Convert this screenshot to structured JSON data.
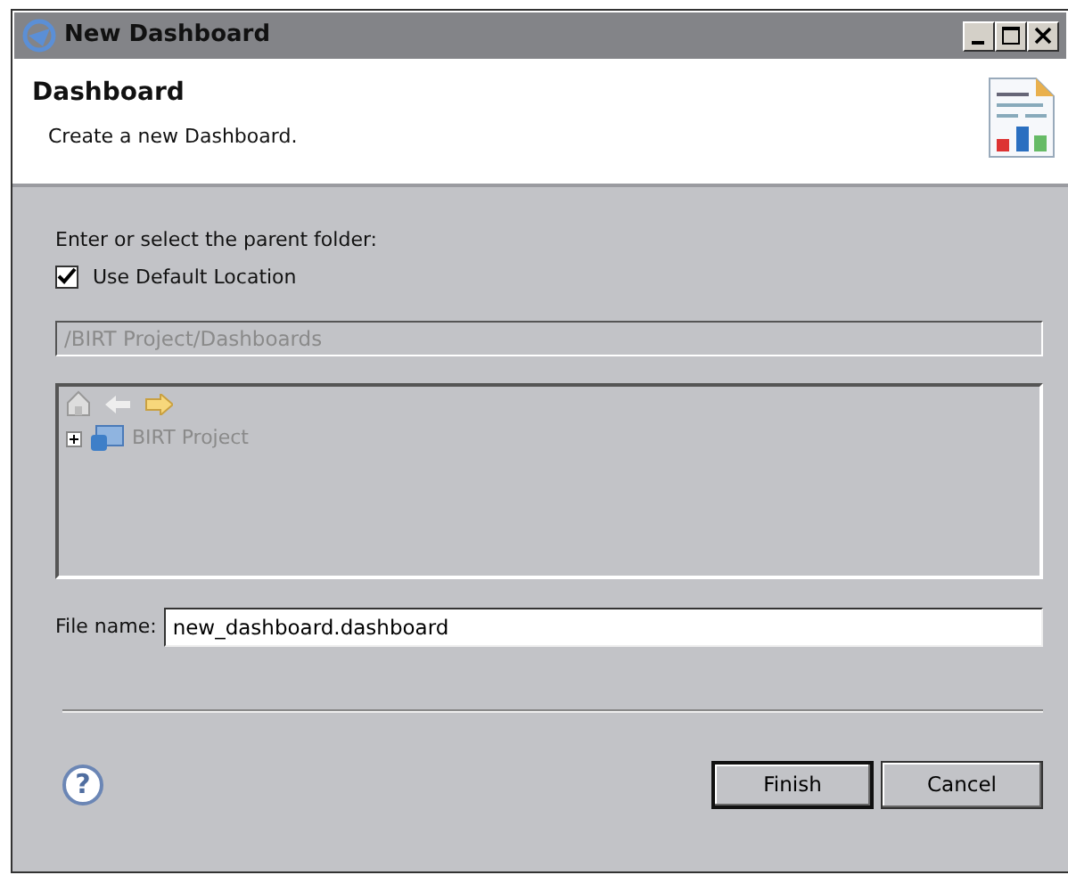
{
  "window": {
    "title": "New Dashboard"
  },
  "header": {
    "title": "Dashboard",
    "description": "Create a new Dashboard."
  },
  "folder_label": "Enter or select the parent folder:",
  "use_default": {
    "label": "Use Default Location",
    "checked": true
  },
  "folder_path": {
    "value": "/BIRT Project/Dashboards",
    "disabled": true
  },
  "tree": {
    "disabled": true,
    "items": [
      {
        "label": "BIRT Project",
        "expanded": false
      }
    ]
  },
  "file_name": {
    "label": "File name:",
    "value": "new_dashboard.dashboard"
  },
  "help": "?",
  "buttons": [
    {
      "label": "Finish",
      "default": true
    },
    {
      "label": "Cancel",
      "default": false
    }
  ]
}
